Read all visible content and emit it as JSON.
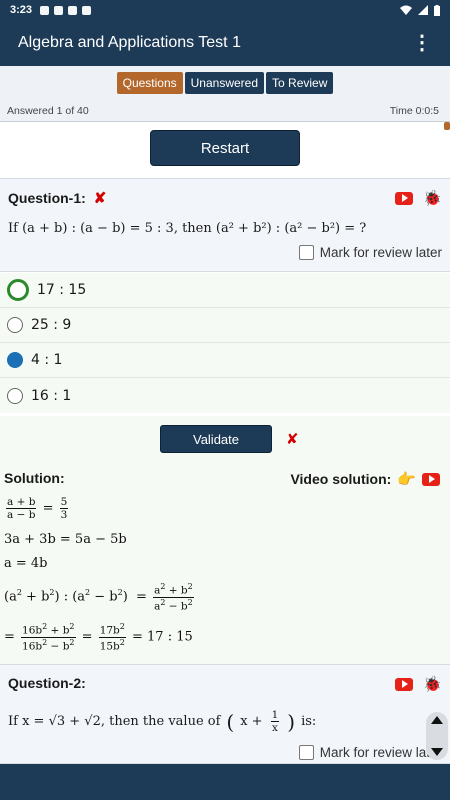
{
  "status_bar": {
    "time": "3:23"
  },
  "app_bar": {
    "title": "Algebra and Applications Test 1",
    "menu_icon": "more-vert-icon"
  },
  "tabs": [
    {
      "label": "Questions",
      "active": true
    },
    {
      "label": "Unanswered",
      "active": false
    },
    {
      "label": "To Review",
      "active": false
    }
  ],
  "progress": {
    "answered": "Answered 1 of 40",
    "time": "Time 0:0:5"
  },
  "restart_label": "Restart",
  "question1": {
    "title": "Question-1:",
    "text": "If (a + b) : (a − b) = 5 : 3, then (a² + b²) : (a² − b²) = ?",
    "mark_review": "Mark for review later",
    "options": [
      "17 : 15",
      "25 : 9",
      "4 : 1",
      "16 : 1"
    ]
  },
  "validate_label": "Validate",
  "solution": {
    "label": "Solution:",
    "video_label": "Video solution:",
    "lines": {
      "l2": "3a + 3b = 5a − 5b",
      "l3": "a = 4b"
    }
  },
  "question2": {
    "title": "Question-2:",
    "text_pre": "If x = √3 + √2, then the value of",
    "text_post": "is:",
    "mark_review": "Mark for review later"
  },
  "colors": {
    "primary": "#1d3b57",
    "accent": "#b3672b",
    "wrong": "#d40000",
    "correct": "#2a8a2a",
    "selected": "#1b6fb5"
  }
}
